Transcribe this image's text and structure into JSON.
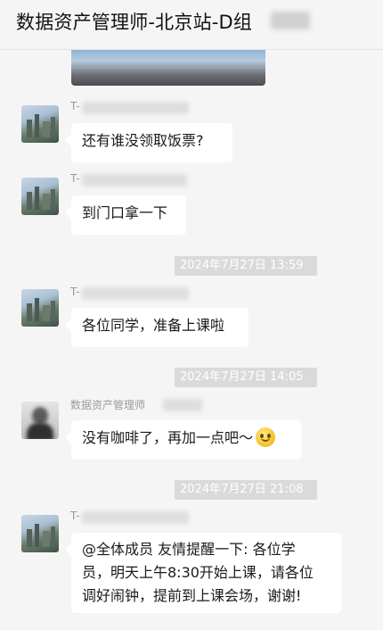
{
  "header": {
    "title": "数据资产管理师-北京站-D组"
  },
  "messages": [
    {
      "sender": "T-",
      "text": "还有谁没领取饭票?"
    },
    {
      "sender": "T-",
      "text": "到门口拿一下"
    },
    {
      "sender": "T-",
      "text": "各位同学，准备上课啦"
    },
    {
      "sender": "数据资产管理师",
      "text": "没有咖啡了，再加一点吧～",
      "emoji": "smiley-face-icon"
    },
    {
      "sender": "T-",
      "text": "@全体成员 友情提醒一下: 各位学\n员，明天上午8:30开始上课，请各位\n调好闹钟，提前到上课会场，谢谢!"
    }
  ],
  "timestamps": [
    "2024年7月27日 13:59",
    "2024年7月27日 14:05",
    "2024年7月27日 21:08"
  ],
  "colors": {
    "background": "#f5f5f5",
    "bubble": "#ffffff",
    "timestamp_bg": "#dadada"
  }
}
